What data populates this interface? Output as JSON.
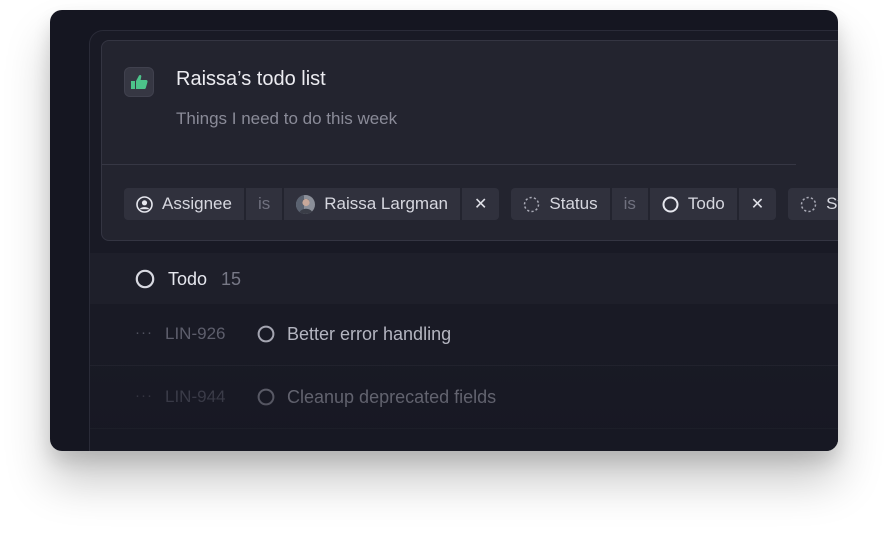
{
  "card": {
    "icon": "thumbs-up-icon",
    "title": "Raissa’s todo list",
    "description": "Things I need to do this week"
  },
  "filters": [
    {
      "field": "Assignee",
      "field_icon": "user-circle-icon",
      "operator": "is",
      "value": "Raissa Largman",
      "value_icon": "avatar",
      "remove": "✕"
    },
    {
      "field": "Status",
      "field_icon": "dashed-circle-icon",
      "operator": "is",
      "value": "Todo",
      "value_icon": "todo-circle-icon",
      "remove": "✕"
    },
    {
      "field": "St",
      "field_icon": "dashed-circle-icon"
    }
  ],
  "group": {
    "label": "Todo",
    "count": "15"
  },
  "issues": [
    {
      "dots": "···",
      "id": "LIN-926",
      "title": "Better error handling"
    },
    {
      "dots": "···",
      "id": "LIN-944",
      "title": "Cleanup deprecated fields"
    }
  ],
  "colors": {
    "accent_green": "#4cc38a",
    "background": "#151621",
    "card": "#23242f"
  }
}
